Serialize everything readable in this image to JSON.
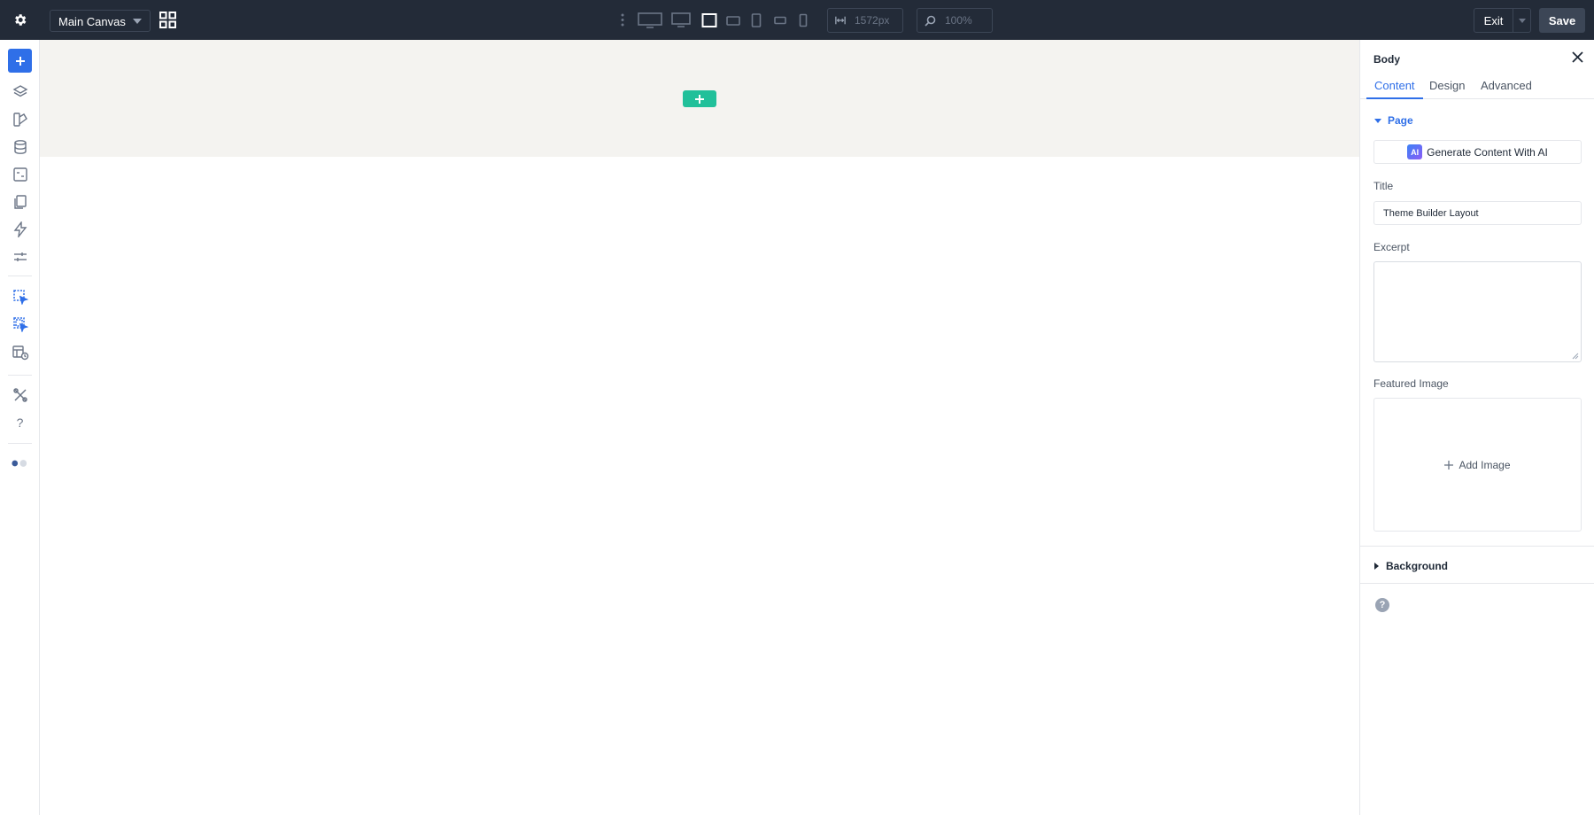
{
  "topbar": {
    "settings_icon": "gear-icon",
    "canvas_select_value": "Main Canvas",
    "canvases_icon": "grid-icon",
    "devices": [
      "desktop-xl",
      "desktop",
      "desktop-active",
      "tablet-landscape",
      "tablet",
      "phone-landscape",
      "phone"
    ],
    "width_value": "1572px",
    "zoom_value": "100%",
    "exit_label": "Exit",
    "save_label": "Save"
  },
  "leftbar": {
    "icons": [
      "add",
      "layers",
      "brush",
      "database",
      "template",
      "pages",
      "lightning",
      "settings-sliders",
      "pointer-one",
      "pointer-many",
      "layout-clock",
      "tools",
      "help",
      "toggle"
    ]
  },
  "canvas": {
    "section_background": "#f4f3f0",
    "add_button_color": "#21c09a"
  },
  "panel": {
    "title": "Body",
    "tabs": [
      "Content",
      "Design",
      "Advanced"
    ],
    "active_tab": "Content",
    "group_page": "Page",
    "ai_badge": "AI",
    "ai_button": "Generate Content With AI",
    "title_label": "Title",
    "title_value": "Theme Builder Layout",
    "excerpt_label": "Excerpt",
    "excerpt_value": "",
    "featured_image_label": "Featured Image",
    "add_image_label": "Add Image",
    "group_background": "Background",
    "help_glyph": "?"
  },
  "colors": {
    "accent": "#2f6fe8",
    "topbar": "#232b38",
    "add_section": "#21c09a"
  }
}
